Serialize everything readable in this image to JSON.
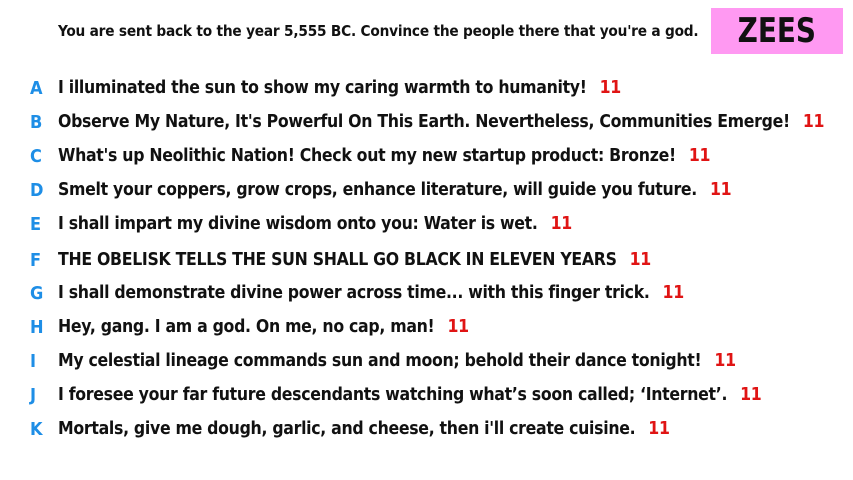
{
  "question": "You are sent back to the year 5,555 BC. Convince the people there that you're a god.",
  "brand_tag": "ZEES",
  "colors": {
    "tag_background": "#ff99f2",
    "letter": "#1e8ee6",
    "score": "#e01414"
  },
  "answers": [
    {
      "letter": "A",
      "text": "I illuminated the sun to show my caring warmth to humanity!",
      "score": "11"
    },
    {
      "letter": "B",
      "text": "Observe My Nature, It's Powerful On This Earth. Nevertheless, Communities Emerge!",
      "score": "11"
    },
    {
      "letter": "C",
      "text": "What's up Neolithic Nation! Check out my new startup product: Bronze!",
      "score": "11"
    },
    {
      "letter": "D",
      "text": "Smelt your coppers, grow crops, enhance literature, will guide you future.",
      "score": "11"
    },
    {
      "letter": "E",
      "text": "I shall impart my divine wisdom onto you: Water is wet.",
      "score": "11"
    },
    {
      "letter": "F",
      "text": "THE OBELISK TELLS THE SUN SHALL GO BLACK IN ELEVEN YEARS",
      "score": "11"
    },
    {
      "letter": "G",
      "text": "I shall demonstrate divine power across time... with this finger trick.",
      "score": "11"
    },
    {
      "letter": "H",
      "text": "Hey, gang. I am a god. On me, no cap, man!",
      "score": "11"
    },
    {
      "letter": "I",
      "text": "My celestial lineage commands sun and moon; behold their dance tonight!",
      "score": "11"
    },
    {
      "letter": "J",
      "text": "I foresee your far future descendants watching what’s soon called; ‘Internet’.",
      "score": "11"
    },
    {
      "letter": "K",
      "text": "Mortals, give me dough, garlic, and cheese, then i'll create cuisine.",
      "score": "11"
    }
  ]
}
